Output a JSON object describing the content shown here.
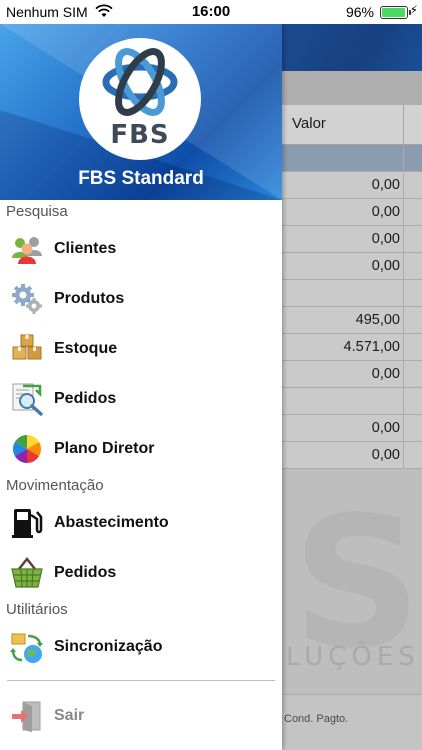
{
  "status": {
    "carrier": "Nenhum SIM",
    "time": "16:00",
    "battery": "96%",
    "battery_level": 0.96
  },
  "drawer": {
    "logo_text": "FBS",
    "app_title": "FBS Standard",
    "sections": [
      {
        "title": "Pesquisa"
      },
      {
        "title": "Movimentação"
      },
      {
        "title": "Utilitários"
      }
    ],
    "items": [
      {
        "label": "Clientes",
        "icon": "users-icon"
      },
      {
        "label": "Produtos",
        "icon": "gear-icon"
      },
      {
        "label": "Estoque",
        "icon": "boxes-icon"
      },
      {
        "label": "Pedidos",
        "icon": "order-search-icon"
      },
      {
        "label": "Plano Diretor",
        "icon": "color-wheel-icon"
      },
      {
        "label": "Abastecimento",
        "icon": "fuel-pump-icon"
      },
      {
        "label": "Pedidos",
        "icon": "shopping-basket-icon"
      },
      {
        "label": "Sincronização",
        "icon": "sync-icon"
      },
      {
        "label": "Sair",
        "icon": "exit-door-icon"
      }
    ]
  },
  "background": {
    "column_header": "Valor",
    "values": [
      "",
      "0,00",
      "0,00",
      "0,00",
      "0,00",
      "",
      "495,00",
      "4.571,00",
      "0,00",
      "",
      "0,00",
      "0,00"
    ],
    "watermark": "S",
    "watermark_sub": "LUÇÕES",
    "footer_text": "Cond. Pagto."
  },
  "colors": {
    "header_blue": "#1f6cc7",
    "battery_green": "#4cd964"
  }
}
